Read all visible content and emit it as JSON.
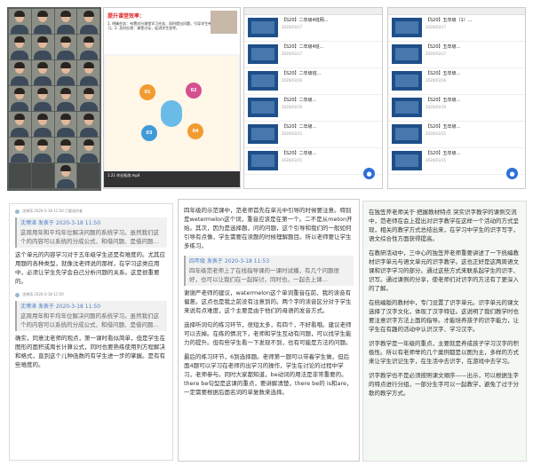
{
  "slide": {
    "title": "提升课堂效率：",
    "text": "1. 明确任务：布置对分课堂学习任务、同时提出问题，引导学生带着问题去学习。2. 及时反馈：课堂讨论，促进学生思考。",
    "bubbles": [
      "01",
      "02",
      "03",
      "04"
    ],
    "bottom": "1.21 作业批改.mp4"
  },
  "list1": {
    "items": [
      {
        "title": "【S20】二年级4班网...",
        "date": "2020/03/17"
      },
      {
        "title": "【S20】二年级4班...",
        "date": "2020/03/17"
      },
      {
        "title": "【S20】二年级班...",
        "date": "2020/03/16"
      },
      {
        "title": "【S20】二年级...",
        "date": "2020/03/16"
      },
      {
        "title": "【S20】二年级...",
        "date": "2020/03/15"
      },
      {
        "title": "【S20】二年级...",
        "date": "2020/03/15"
      }
    ]
  },
  "list2": {
    "items": [
      {
        "title": "【S20】五年级（1）...",
        "date": "2020/03/17"
      },
      {
        "title": "【S20】五年级...",
        "date": "2020/03/17"
      },
      {
        "title": "【S20】五年级...",
        "date": "2020/03/16"
      },
      {
        "title": "【S20】五年级...",
        "date": "2020/03/16"
      },
      {
        "title": "【S20】五年级...",
        "date": "2020/03/15"
      },
      {
        "title": "【S20】五年级...",
        "date": "2020/03/15"
      }
    ]
  },
  "chat1": {
    "meta1": "沈博涛 2020-3-18 11:50 只看该作者",
    "quote1_head": "沈博涛 发表于 2020-3-18 11:50",
    "quote1": "这周用年和平均年位解决问题的系统学习。虽然我们这个的内容可以系统的分成公式、和借问题、是借问题…",
    "para1": "这个单元的内容学习对于五年级学生还是有难度的。尤其应用题的各种类型，就像沈老师说的那样，在学习这类应用中，必须让学生先学会自己分析问题的关系。这是很重要的。",
    "meta2": "沈博涛 2020-3-18 11:50",
    "quote2_head": "沈博涛 发表于 2020-3-18 11:50",
    "quote2": "这周用年和平均年位解决问题的系统学习。虽然我们这个的内容可以系统的分成公式、和借问题、是借问题…",
    "para2": "确实，同意沈老师的观点，第一课时看似简单，但是学生在图形的面积或周长计算公式，同时也要熟练使用列方程解决和格式，直到这个儿种函数的有学生进一步的掌握。是有有些难度的。"
  },
  "chat2": {
    "para1": "四年级的示范课中，范老师首先在单元中引导的时候要注意。特别是wetermelon这个词，重音应该是在第一个。二不是从meton开始。其次，因为是选择题，问的问题，这个引导和我们的一般如何引导有点像，学生需要在读题的时候理解题目。所以老师要让学生多练习。",
    "quote_head": "四年级 发表于 2020-3-18 11:53",
    "quote": "四年级范老师上了在线指导课的一课时试播，有几个问题很好，也可以让我们在一起探讨，同时也，一起去上课…",
    "para2": "谢谢严老师的建议，watermelon这个单词重音在前，我的读音有偏差。这点也是我之前没有注意到的。两个字的读音区分对于学生来说有点难度，这个主要是由于他们的母语的发音方式。",
    "para3": "选择听词句的练习环节，很短太多，有四个，不好看哦。建议老师可以去掉。在练的情况下，老师和学生互动有问题，可以找学生能力的提升。但有些学生看一下发现不到，也有可能是方法的问题。",
    "para4": "最后的练习环节，6到选择题。老师第一题可以带着学生做，但后面4题可以学习在老师的出学习的操作，学生在讨论的过程中学习，老师参与。同时大家都知道，be动词的用法是非常重要的。there be句型是这课的重点，要讲解清楚，there be的 is和are，一定需要根据后面名词的单复数来选择。"
  },
  "chat3": {
    "para1": "在独笠斧老师关于·把握教材特点 突实识字教学的课例交流中，范老师在会上提出对识字教学在这样一个活动的方式呈现，相关的教学方式总结出来，在学习中学生的识字写字，语文综合性方面获得提高。",
    "para2": "在教研活动中，三中心的独笠斧老师重要讲述了一下统编教材识字单元与语文单元的识字教学。这也正好是这两周语文课和识字学习的部分。通过这些方式来联系起学生的识字、识写。通过课例的分享，使老师们对识字的方法有了更深入的了解。",
    "para3": "在统编版的教材中，专门设置了识字单元。识字单元的课文选择了汉字文化，体现了汉字特征。这说明了我们教学时也要注意识字方法上面的指导。才能培养孩子的识字能力，让学生在有趣的活动中认识汉字、学习汉字。",
    "para4": "识字教学是一年级的重点，主要就是养成孩子学习汉字的积极性。所以有老师举的几个案例都是以图为主，多样的方式来让学生识记生字，在生活中去识字，在游戏中去学习。",
    "para5": "识字教学也不是必须按照课文顺序——出示，可以根据生字的特点进行分组，一部分生字可以一起教学，避免了过于分散的教学方式。"
  }
}
